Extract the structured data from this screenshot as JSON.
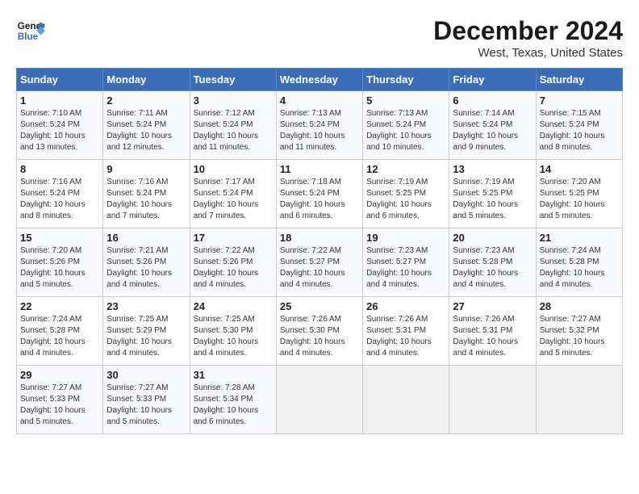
{
  "logo": {
    "line1": "General",
    "line2": "Blue"
  },
  "title": "December 2024",
  "location": "West, Texas, United States",
  "headers": [
    "Sunday",
    "Monday",
    "Tuesday",
    "Wednesday",
    "Thursday",
    "Friday",
    "Saturday"
  ],
  "weeks": [
    [
      {
        "day": "1",
        "sunrise": "7:10 AM",
        "sunset": "5:24 PM",
        "daylight": "10 hours and 13 minutes."
      },
      {
        "day": "2",
        "sunrise": "7:11 AM",
        "sunset": "5:24 PM",
        "daylight": "10 hours and 12 minutes."
      },
      {
        "day": "3",
        "sunrise": "7:12 AM",
        "sunset": "5:24 PM",
        "daylight": "10 hours and 11 minutes."
      },
      {
        "day": "4",
        "sunrise": "7:13 AM",
        "sunset": "5:24 PM",
        "daylight": "10 hours and 11 minutes."
      },
      {
        "day": "5",
        "sunrise": "7:13 AM",
        "sunset": "5:24 PM",
        "daylight": "10 hours and 10 minutes."
      },
      {
        "day": "6",
        "sunrise": "7:14 AM",
        "sunset": "5:24 PM",
        "daylight": "10 hours and 9 minutes."
      },
      {
        "day": "7",
        "sunrise": "7:15 AM",
        "sunset": "5:24 PM",
        "daylight": "10 hours and 8 minutes."
      }
    ],
    [
      {
        "day": "8",
        "sunrise": "7:16 AM",
        "sunset": "5:24 PM",
        "daylight": "10 hours and 8 minutes."
      },
      {
        "day": "9",
        "sunrise": "7:16 AM",
        "sunset": "5:24 PM",
        "daylight": "10 hours and 7 minutes."
      },
      {
        "day": "10",
        "sunrise": "7:17 AM",
        "sunset": "5:24 PM",
        "daylight": "10 hours and 7 minutes."
      },
      {
        "day": "11",
        "sunrise": "7:18 AM",
        "sunset": "5:24 PM",
        "daylight": "10 hours and 6 minutes."
      },
      {
        "day": "12",
        "sunrise": "7:19 AM",
        "sunset": "5:25 PM",
        "daylight": "10 hours and 6 minutes."
      },
      {
        "day": "13",
        "sunrise": "7:19 AM",
        "sunset": "5:25 PM",
        "daylight": "10 hours and 5 minutes."
      },
      {
        "day": "14",
        "sunrise": "7:20 AM",
        "sunset": "5:25 PM",
        "daylight": "10 hours and 5 minutes."
      }
    ],
    [
      {
        "day": "15",
        "sunrise": "7:20 AM",
        "sunset": "5:26 PM",
        "daylight": "10 hours and 5 minutes."
      },
      {
        "day": "16",
        "sunrise": "7:21 AM",
        "sunset": "5:26 PM",
        "daylight": "10 hours and 4 minutes."
      },
      {
        "day": "17",
        "sunrise": "7:22 AM",
        "sunset": "5:26 PM",
        "daylight": "10 hours and 4 minutes."
      },
      {
        "day": "18",
        "sunrise": "7:22 AM",
        "sunset": "5:27 PM",
        "daylight": "10 hours and 4 minutes."
      },
      {
        "day": "19",
        "sunrise": "7:23 AM",
        "sunset": "5:27 PM",
        "daylight": "10 hours and 4 minutes."
      },
      {
        "day": "20",
        "sunrise": "7:23 AM",
        "sunset": "5:28 PM",
        "daylight": "10 hours and 4 minutes."
      },
      {
        "day": "21",
        "sunrise": "7:24 AM",
        "sunset": "5:28 PM",
        "daylight": "10 hours and 4 minutes."
      }
    ],
    [
      {
        "day": "22",
        "sunrise": "7:24 AM",
        "sunset": "5:28 PM",
        "daylight": "10 hours and 4 minutes."
      },
      {
        "day": "23",
        "sunrise": "7:25 AM",
        "sunset": "5:29 PM",
        "daylight": "10 hours and 4 minutes."
      },
      {
        "day": "24",
        "sunrise": "7:25 AM",
        "sunset": "5:30 PM",
        "daylight": "10 hours and 4 minutes."
      },
      {
        "day": "25",
        "sunrise": "7:26 AM",
        "sunset": "5:30 PM",
        "daylight": "10 hours and 4 minutes."
      },
      {
        "day": "26",
        "sunrise": "7:26 AM",
        "sunset": "5:31 PM",
        "daylight": "10 hours and 4 minutes."
      },
      {
        "day": "27",
        "sunrise": "7:26 AM",
        "sunset": "5:31 PM",
        "daylight": "10 hours and 4 minutes."
      },
      {
        "day": "28",
        "sunrise": "7:27 AM",
        "sunset": "5:32 PM",
        "daylight": "10 hours and 5 minutes."
      }
    ],
    [
      {
        "day": "29",
        "sunrise": "7:27 AM",
        "sunset": "5:33 PM",
        "daylight": "10 hours and 5 minutes."
      },
      {
        "day": "30",
        "sunrise": "7:27 AM",
        "sunset": "5:33 PM",
        "daylight": "10 hours and 5 minutes."
      },
      {
        "day": "31",
        "sunrise": "7:28 AM",
        "sunset": "5:34 PM",
        "daylight": "10 hours and 6 minutes."
      },
      null,
      null,
      null,
      null
    ]
  ],
  "colors": {
    "header_bg": "#3a6db5",
    "header_text": "#ffffff",
    "odd_row": "#f7f9fc",
    "even_row": "#ffffff",
    "empty_cell": "#f0f0f0"
  }
}
